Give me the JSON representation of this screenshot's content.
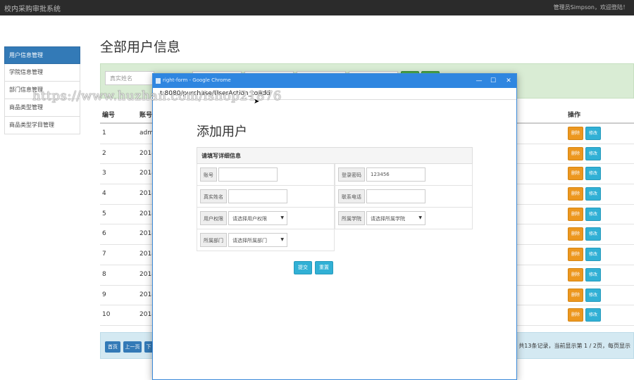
{
  "topbar": {
    "app_title": "校内采购审批系统",
    "user_greeting": "管理员Simpson，欢迎登陆！"
  },
  "sidebar": {
    "items": [
      {
        "label": "用户信息管理",
        "active": true
      },
      {
        "label": "学院信息管理"
      },
      {
        "label": "部门信息管理"
      },
      {
        "label": "商品类型管理"
      },
      {
        "label": "商品类型学目管理"
      }
    ]
  },
  "page_title": "全部用户信息",
  "filter": {
    "realname_placeholder": "真实姓名"
  },
  "table": {
    "headers": {
      "id": "编号",
      "account": "账号",
      "ops": "操作"
    },
    "rows": [
      {
        "id": "1",
        "account": "adm"
      },
      {
        "id": "2",
        "account": "2018"
      },
      {
        "id": "3",
        "account": "2018"
      },
      {
        "id": "4",
        "account": "2018"
      },
      {
        "id": "5",
        "account": "2018"
      },
      {
        "id": "6",
        "account": "2018"
      },
      {
        "id": "7",
        "account": "2018"
      },
      {
        "id": "8",
        "account": "2018"
      },
      {
        "id": "9",
        "account": "2018"
      },
      {
        "id": "10",
        "account": "2018"
      }
    ],
    "delete_label": "删除",
    "edit_label": "修改"
  },
  "pager": {
    "first": "首页",
    "prev": "上一页",
    "next": "下",
    "info": "共13条记录，当前显示第 1 / 2页，每页显示"
  },
  "modal": {
    "window_title": "right-form - Google Chrome",
    "url": "t:8080/purchase/UserAction_toAdd",
    "form_title": "添加用户",
    "panel_title": "请填写详细信息",
    "fields": {
      "account_label": "账号",
      "account_value": "",
      "password_label": "登录密码",
      "password_value": "123456",
      "realname_label": "真实姓名",
      "realname_value": "",
      "phone_label": "联系电话",
      "phone_value": "",
      "role_label": "用户权限",
      "role_value": "请选择用户权限",
      "college_label": "所属学院",
      "college_value": "请选择所属学院",
      "dept_label": "所属部门",
      "dept_value": "请选择所属部门"
    },
    "submit_label": "提交",
    "reset_label": "重置"
  },
  "watermark": "https://www.huzhan.com/ishop21876"
}
